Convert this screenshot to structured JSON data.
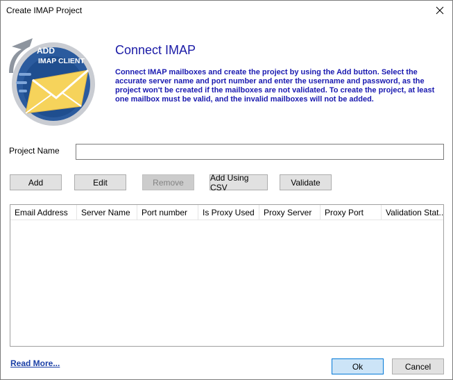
{
  "window": {
    "title": "Create IMAP Project"
  },
  "logo": {
    "line1": "ADD",
    "line2": "IMAP CLIENT"
  },
  "header": {
    "heading": "Connect IMAP",
    "description": "Connect IMAP mailboxes and create the project  by using the Add button. Select the accurate server name and port number and enter the username and password, as the project won't be created if the mailboxes are not validated.  To create the project, at least one mailbox must be valid, and the invalid mailboxes will not be added."
  },
  "form": {
    "project_label": "Project Name",
    "project_value": ""
  },
  "toolbar": {
    "add": "Add",
    "edit": "Edit",
    "remove": "Remove",
    "add_csv": "Add Using CSV",
    "validate": "Validate"
  },
  "grid": {
    "columns": [
      "Email Address",
      "Server Name",
      "Port number",
      "Is Proxy Used",
      "Proxy Server",
      "Proxy Port",
      "Validation Stat..."
    ],
    "rows": []
  },
  "footer": {
    "read_more": "Read More...",
    "ok": "Ok",
    "cancel": "Cancel"
  },
  "colors": {
    "heading": "#1a1aa6",
    "description": "#1a1ab0",
    "logo_ring": "#2a5a9c",
    "envelope": "#f6d35b"
  }
}
